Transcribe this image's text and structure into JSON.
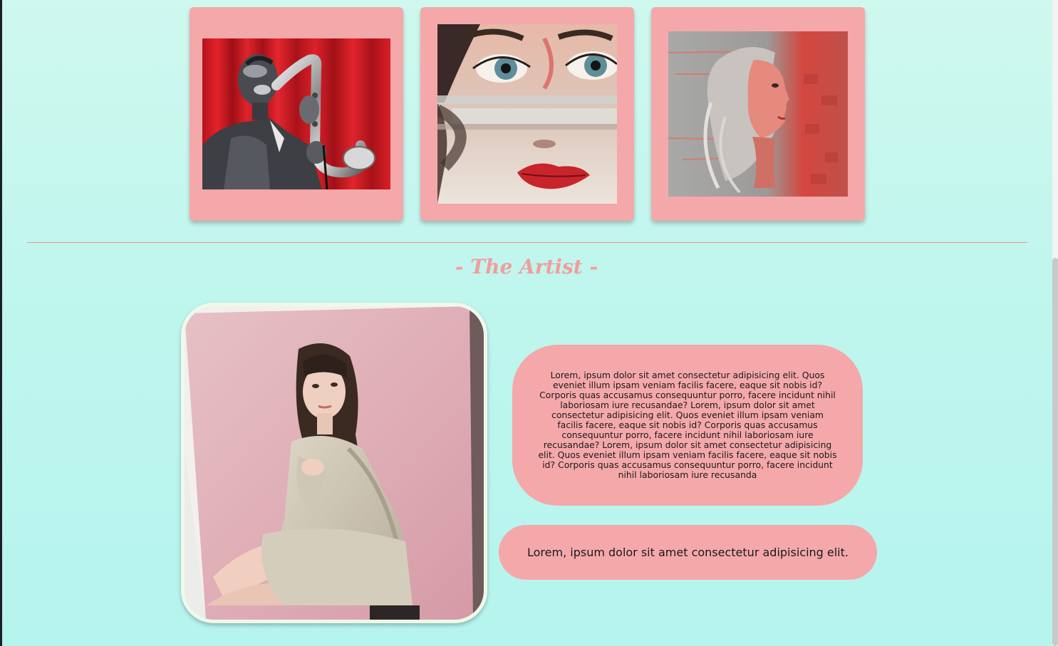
{
  "gallery": {
    "artworks": [
      {
        "subject": "saxophone player painting"
      },
      {
        "subject": "distorted face painting"
      },
      {
        "subject": "woman profile painting"
      }
    ]
  },
  "artist_section": {
    "title": "- The Artist -",
    "bio": "Lorem, ipsum dolor sit amet consectetur adipisicing elit. Quos eveniet illum ipsam veniam facilis facere, eaque sit nobis id? Corporis quas accusamus consequuntur porro, facere incidunt nihil laboriosam iure recusandae? Lorem, ipsum dolor sit amet consectetur adipisicing elit. Quos eveniet illum ipsam veniam facilis facere, eaque sit nobis id? Corporis quas accusamus consequuntur porro, facere incidunt nihil laboriosam iure recusandae? Lorem, ipsum dolor sit amet consectetur adipisicing elit. Quos eveniet illum ipsam veniam facilis facere, eaque sit nobis id? Corporis quas accusamus consequuntur porro, facere incidunt nihil laboriosam iure recusanda",
    "tagline": "Lorem, ipsum dolor sit amet consectetur adipisicing elit."
  },
  "colors": {
    "card": "#f5a8aa",
    "title": "#f29d9d",
    "background_top": "#cff8ee",
    "background_bottom": "#b6f4ee",
    "frame_border": "#eef9ea"
  }
}
